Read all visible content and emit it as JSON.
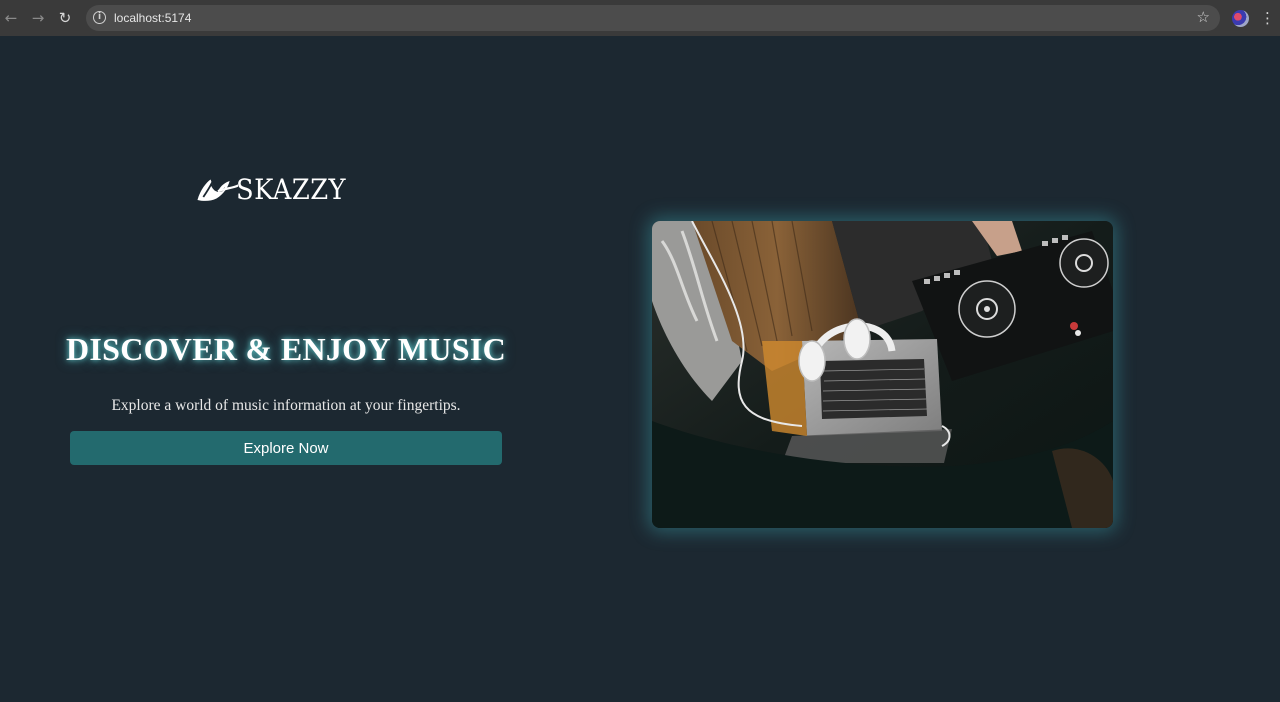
{
  "browser": {
    "url": "localhost:5174",
    "icons": [
      "back-arrow-icon",
      "forward-arrow-icon",
      "reload-icon",
      "site-info-icon",
      "bookmark-star-icon",
      "profile-avatar",
      "menu-kebab-icon"
    ]
  },
  "brand": {
    "logo_text": "SKAZZY"
  },
  "hero": {
    "title": "DISCOVER & ENJOY MUSIC",
    "subtitle": "Explore a world of music information at your fingertips.",
    "cta_label": "Explore Now"
  },
  "colors": {
    "page_background": "#1c2831",
    "button_background": "#236a6e",
    "title_glow": "#6edcdc"
  }
}
